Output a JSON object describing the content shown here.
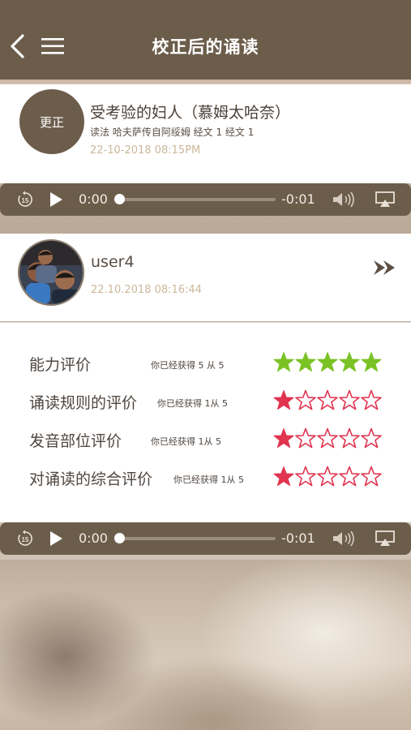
{
  "header": {
    "title": "校正后的诵读",
    "back_icon": "chevron-left-icon",
    "menu_icon": "hamburger-menu-icon"
  },
  "recitation": {
    "badge_label": "更正",
    "title": "受考验的妇人（慕姆太哈奈）",
    "subtitle": "读法 哈夫萨传自阿绥姆 经文 1 经文 1",
    "datetime": "22-10-2018 08:15PM"
  },
  "player_top": {
    "current_time": "0:00",
    "remaining_time": "-0:01",
    "progress": 0
  },
  "user": {
    "name": "user4",
    "datetime": "22.10.2018 08:16:44",
    "forward_icon": "double-chevron-right-icon"
  },
  "ratings": [
    {
      "label": "能力评价",
      "score_text": "你已经获得 5 从 5",
      "stars": 5,
      "max": 5,
      "color": "#7ac225"
    },
    {
      "label": "诵读规则的评价",
      "score_text": "你已经获得 1从 5",
      "stars": 1,
      "max": 5,
      "color": "#e0344f"
    },
    {
      "label": "发音部位评价",
      "score_text": "你已经获得 1从 5",
      "stars": 1,
      "max": 5,
      "color": "#e0344f"
    },
    {
      "label": "对诵读的综合评价",
      "score_text": "你已经获得 1从 5",
      "stars": 1,
      "max": 5,
      "color": "#e0344f"
    }
  ],
  "player_bottom": {
    "current_time": "0:00",
    "remaining_time": "-0:01",
    "progress": 0
  },
  "colors": {
    "brand": "#6c5d4b",
    "date_text": "#cbb79a",
    "star_full_high": "#7ac225",
    "star_low": "#e0344f"
  }
}
